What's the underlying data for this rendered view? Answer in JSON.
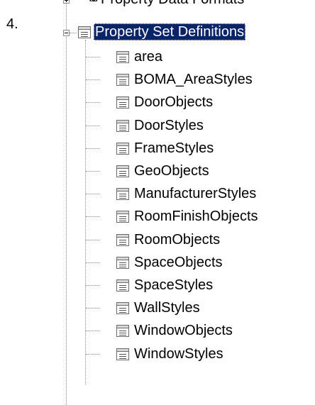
{
  "step_number": "4.",
  "tree": {
    "above_node": {
      "icon": "ab-format-icon",
      "icon_text": "ab",
      "label": "Property Data Formats"
    },
    "selected_node": {
      "label": "Property Set Definitions",
      "icon": "list-icon",
      "expanded": true
    },
    "children": [
      {
        "label": "area"
      },
      {
        "label": "BOMA_AreaStyles"
      },
      {
        "label": "DoorObjects"
      },
      {
        "label": "DoorStyles"
      },
      {
        "label": "FrameStyles"
      },
      {
        "label": "GeoObjects"
      },
      {
        "label": "ManufacturerStyles"
      },
      {
        "label": "RoomFinishObjects"
      },
      {
        "label": "RoomObjects"
      },
      {
        "label": "SpaceObjects"
      },
      {
        "label": "SpaceStyles"
      },
      {
        "label": "WallStyles"
      },
      {
        "label": "WindowObjects"
      },
      {
        "label": "WindowStyles"
      }
    ]
  },
  "colors": {
    "selection_background": "#0a246a",
    "selection_text": "#ffffff",
    "tree_line": "#8a8a8a"
  }
}
